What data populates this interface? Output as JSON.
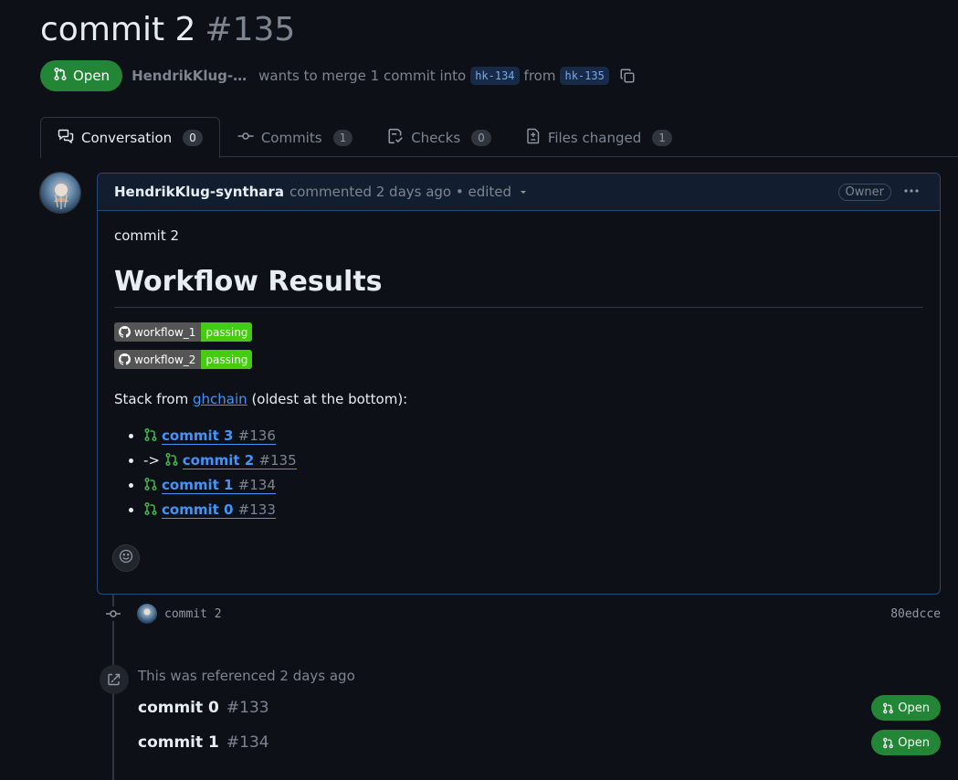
{
  "pr": {
    "title": "commit 2",
    "number": "#135",
    "state": "Open",
    "author": "HendrikKlug-…",
    "merge_text_1": "wants to merge 1 commit into",
    "base_branch": "hk-134",
    "merge_text_2": "from",
    "head_branch": "hk-135"
  },
  "tabs": [
    {
      "label": "Conversation",
      "count": "0",
      "icon": "comment-discussion-icon"
    },
    {
      "label": "Commits",
      "count": "1",
      "icon": "git-commit-icon"
    },
    {
      "label": "Checks",
      "count": "0",
      "icon": "checklist-icon"
    },
    {
      "label": "Files changed",
      "count": "1",
      "icon": "file-diff-icon"
    }
  ],
  "comment": {
    "author": "HendrikKlug-synthara",
    "meta": "commented 2 days ago • edited",
    "role": "Owner",
    "body_line": "commit 2",
    "heading": "Workflow Results",
    "badges": [
      {
        "label": "workflow_1",
        "status": "passing"
      },
      {
        "label": "workflow_2",
        "status": "passing"
      }
    ],
    "stack_prefix": "Stack from",
    "stack_link": "ghchain",
    "stack_suffix": "(oldest at the bottom):",
    "stack": [
      {
        "prefix": "",
        "title": "commit 3",
        "number": "#136"
      },
      {
        "prefix": "->",
        "title": "commit 2",
        "number": "#135"
      },
      {
        "prefix": "",
        "title": "commit 1",
        "number": "#134"
      },
      {
        "prefix": "",
        "title": "commit 0",
        "number": "#133"
      }
    ]
  },
  "commit_event": {
    "message": "commit 2",
    "sha": "80edcce"
  },
  "references": {
    "text": "This was referenced 2 days ago",
    "items": [
      {
        "title": "commit 0",
        "number": "#133",
        "state": "Open"
      },
      {
        "title": "commit 1",
        "number": "#134",
        "state": "Open"
      }
    ]
  },
  "colors": {
    "open_green": "#238636",
    "link_blue": "#4493f8",
    "passing_green": "#44cc11"
  }
}
